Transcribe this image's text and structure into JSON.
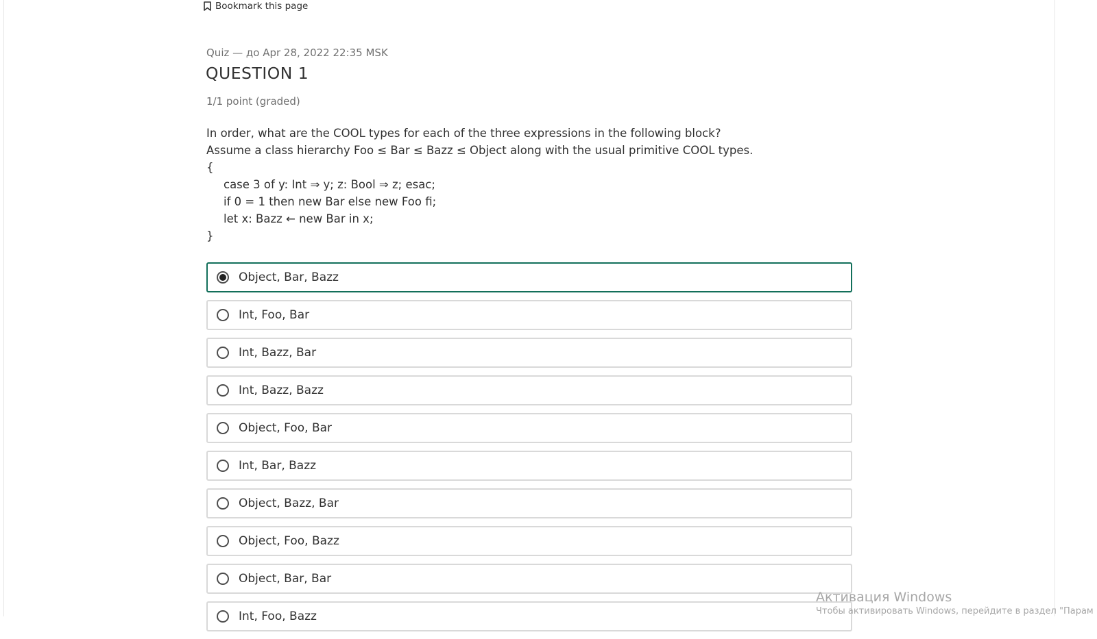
{
  "bookmark": {
    "label": "Bookmark this page",
    "icon": "bookmark-icon"
  },
  "quiz": {
    "meta": "Quiz — до Apr 28, 2022 22:35 MSK",
    "title": "QUESTION 1",
    "points": "1/1 point (graded)"
  },
  "prompt": {
    "line1": "In order, what are the COOL types for each of the three expressions in the following block?",
    "line2": "Assume a class hierarchy Foo ≤ Bar ≤ Bazz ≤ Object along with the usual primitive COOL types.",
    "line3": "{",
    "line4": "case 3 of y: Int ⇒ y; z: Bool ⇒ z; esac;",
    "line5": "if 0 = 1 then new Bar else new Foo fi;",
    "line6": "let x: Bazz ← new Bar in x;",
    "line7": "}"
  },
  "choices": [
    {
      "label": "Object, Bar, Bazz",
      "selected": true
    },
    {
      "label": "Int, Foo, Bar",
      "selected": false
    },
    {
      "label": "Int, Bazz, Bar",
      "selected": false
    },
    {
      "label": "Int, Bazz, Bazz",
      "selected": false
    },
    {
      "label": "Object, Foo, Bar",
      "selected": false
    },
    {
      "label": "Int, Bar, Bazz",
      "selected": false
    },
    {
      "label": "Object, Bazz, Bar",
      "selected": false
    },
    {
      "label": "Object, Foo, Bazz",
      "selected": false
    },
    {
      "label": "Object, Bar, Bar",
      "selected": false
    },
    {
      "label": "Int, Foo, Bazz",
      "selected": false
    }
  ],
  "watermark": {
    "line1": "Активация Windows",
    "line2": "Чтобы активировать Windows, перейдите в раздел \"Парам"
  },
  "colors": {
    "selected_border": "#126f5a",
    "border": "#d9d9d9",
    "text": "#313131",
    "muted": "#707070"
  }
}
